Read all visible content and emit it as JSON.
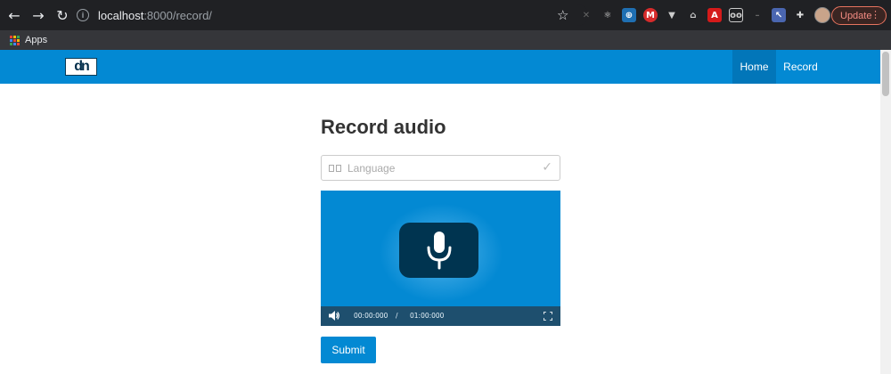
{
  "browser": {
    "url_host": "localhost",
    "url_rest": ":8000/record/",
    "update_label": "Update",
    "bookmarks_apps": "Apps"
  },
  "navbar": {
    "logo_text": "dn",
    "home_label": "Home",
    "record_label": "Record"
  },
  "main": {
    "title": "Record audio",
    "language_placeholder": "Language",
    "recorder": {
      "current_time": "00:00:000",
      "separator": "/",
      "total_time": "01:00:000"
    },
    "submit_label": "Submit"
  },
  "colors": {
    "brand_blue": "#0389d3",
    "nav_active": "#0276b9",
    "mic_bg": "#003450",
    "controls_bg": "#1e4f6e"
  }
}
